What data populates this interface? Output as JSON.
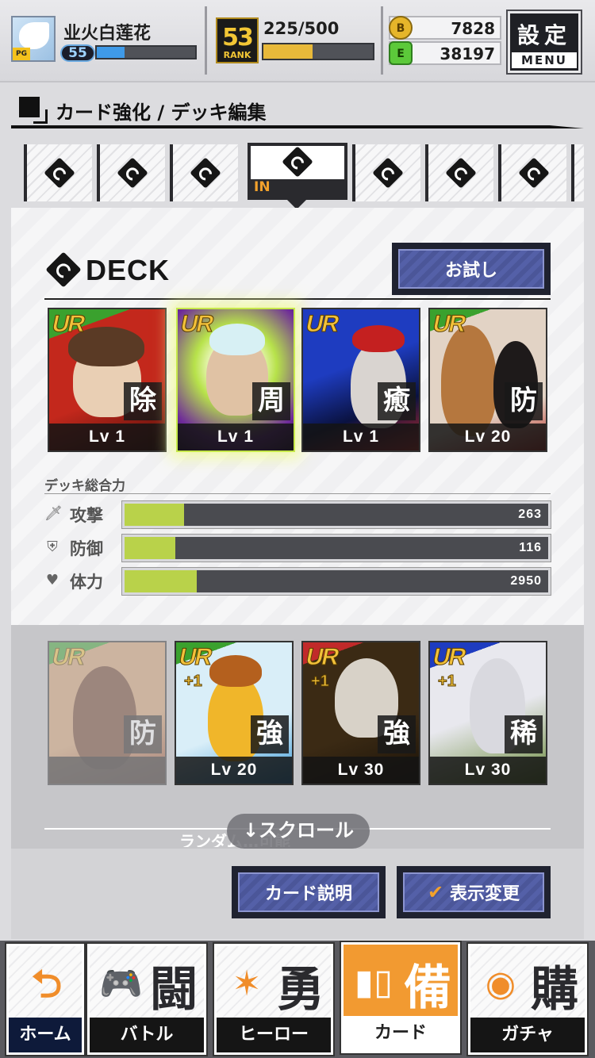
{
  "header": {
    "player_name": "业火白莲花",
    "player_level": "55",
    "exp_fraction": 0.28,
    "rank_number": "53",
    "rank_label": "RANK",
    "stamina_text": "225/500",
    "stamina_fraction": 0.45,
    "coin_icon_text": "B",
    "coin_value": "7828",
    "energy_icon_text": "E",
    "energy_value": "38197",
    "menu_kanji": "設定",
    "menu_label": "MENU"
  },
  "page": {
    "title": "カード強化 / デッキ編集"
  },
  "deck_tabs": {
    "active_index": 3,
    "active_label": "IN",
    "count": 8
  },
  "deck": {
    "heading": "DECK",
    "trial_button": "お試し",
    "cards": [
      {
        "rarity": "UR",
        "skill": "除",
        "level": "Lv 1",
        "bg": "#c0281e"
      },
      {
        "rarity": "UR",
        "skill": "周",
        "level": "Lv 1",
        "bg": "#7a3aa8"
      },
      {
        "rarity": "UR",
        "skill": "癒",
        "level": "Lv 1",
        "bg": "#1a3aa8"
      },
      {
        "rarity": "UR",
        "skill": "防",
        "level": "Lv 20",
        "bg": "#d8b49a"
      }
    ],
    "stats_title": "デッキ総合力",
    "stats": [
      {
        "label": "攻撃",
        "icon": "sword-icon",
        "value": "263",
        "fraction": 0.14
      },
      {
        "label": "防御",
        "icon": "shield-icon",
        "value": "116",
        "fraction": 0.12
      },
      {
        "label": "体力",
        "icon": "heart-icon",
        "value": "2950",
        "fraction": 0.17
      }
    ]
  },
  "reserve": {
    "cards": [
      {
        "rarity": "UR",
        "skill": "防",
        "level": "",
        "plus": ""
      },
      {
        "rarity": "UR",
        "skill": "強",
        "level": "Lv 20",
        "plus": "+1"
      },
      {
        "rarity": "UR",
        "skill": "強",
        "level": "Lv 30",
        "plus": "+1"
      },
      {
        "rarity": "UR",
        "skill": "稀",
        "level": "Lv 30",
        "plus": "+1"
      }
    ],
    "partial_text": "ランダム…可能",
    "scroll_hint": "↓スクロール"
  },
  "actions": {
    "card_info": "カード説明",
    "change_display": "表示変更"
  },
  "bottom_nav": [
    {
      "kanji": "",
      "label": "ホーム",
      "icon": "back-arrow-icon"
    },
    {
      "kanji": "闘",
      "label": "バトル",
      "icon": "gamepad-icon"
    },
    {
      "kanji": "勇",
      "label": "ヒーロー",
      "icon": "hero-icon"
    },
    {
      "kanji": "備",
      "label": "カード",
      "icon": "cards-icon"
    },
    {
      "kanji": "購",
      "label": "ガチャ",
      "icon": "gacha-icon"
    }
  ],
  "colors": {
    "accent_orange": "#f29a31",
    "stat_fill": "#b9d24a",
    "exp_fill": "#3f9ae8",
    "stamina_fill": "#e8b93a"
  }
}
